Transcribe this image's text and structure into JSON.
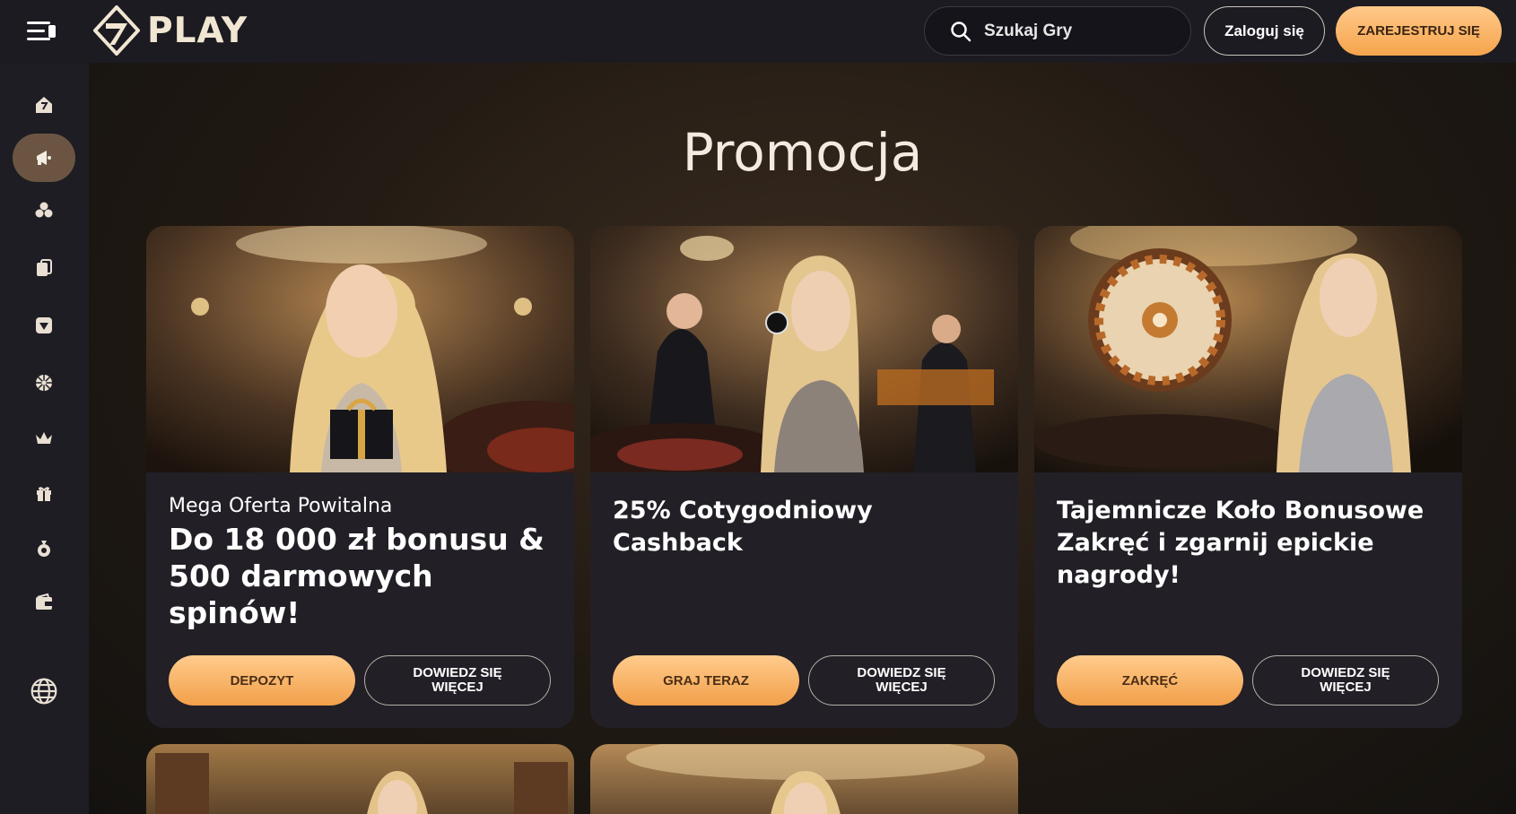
{
  "header": {
    "logo_text": "PLAY",
    "search_placeholder": "Szukaj Gry",
    "login_label": "Zaloguj się",
    "register_label": "ZAREJESTRUJ SIĘ"
  },
  "sidebar": {
    "items": [
      {
        "icon": "home-icon",
        "active": false
      },
      {
        "icon": "promo-megaphone-icon",
        "active": true
      },
      {
        "icon": "casino-chips-icon",
        "active": false
      },
      {
        "icon": "cards-icon",
        "active": false
      },
      {
        "icon": "diamond-icon",
        "active": false
      },
      {
        "icon": "wheel-icon",
        "active": false
      },
      {
        "icon": "crown-icon",
        "active": false
      },
      {
        "icon": "gift-icon",
        "active": false
      },
      {
        "icon": "moneybag-icon",
        "active": false
      },
      {
        "icon": "wallet-icon",
        "active": false
      },
      {
        "icon": "globe-icon",
        "active": false
      }
    ]
  },
  "main": {
    "title": "Promocja",
    "cards": [
      {
        "subtitle": "Mega Oferta Powitalna",
        "title": "Do 18 000 zł bonusu & 500 darmowych spinów!",
        "primary_label": "DEPOZYT",
        "secondary_label": "DOWIEDZ SIĘ WIĘCEJ"
      },
      {
        "subtitle": "",
        "title": "25% Cotygodniowy Cashback",
        "primary_label": "GRAJ TERAZ",
        "secondary_label": "DOWIEDZ SIĘ WIĘCEJ"
      },
      {
        "subtitle": "",
        "title": "Tajemnicze Koło Bonusowe Zakręć i zgarnij epickie nagrody!",
        "primary_label": "ZAKRĘĆ",
        "secondary_label": "DOWIEDZ SIĘ WIĘCEJ"
      }
    ]
  },
  "colors": {
    "accent": "#f5a44c",
    "header_bg": "#1c1b22",
    "sidebar_bg": "#1e1d24",
    "card_bg": "#221f26",
    "active_item": "#6b5542"
  }
}
